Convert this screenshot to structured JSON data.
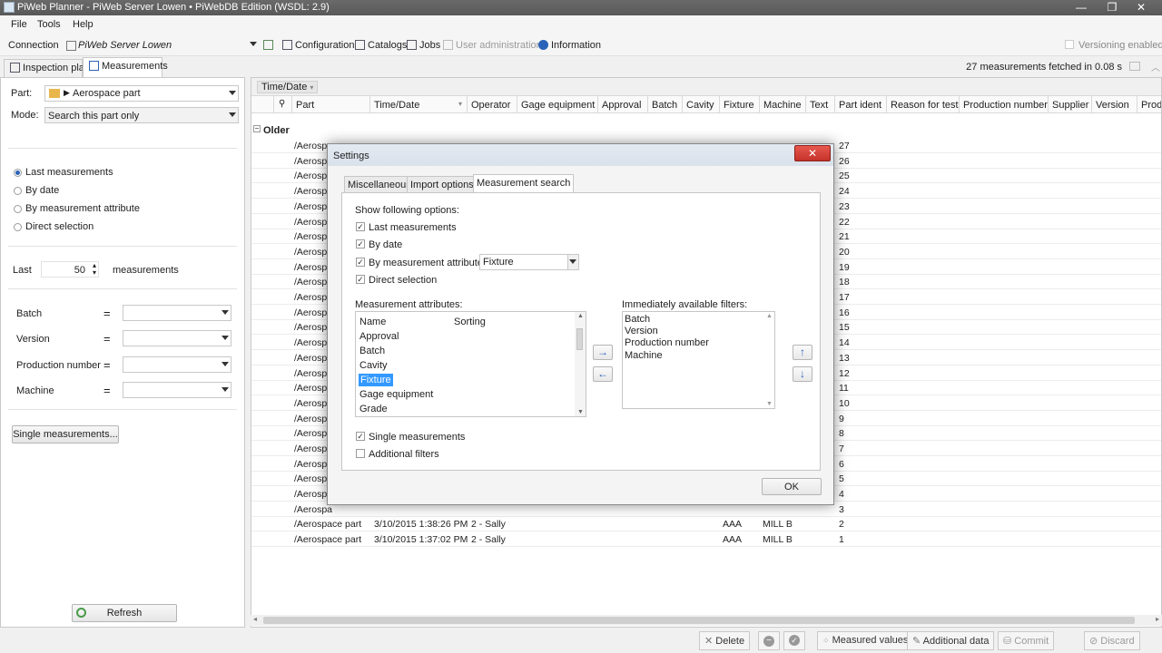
{
  "window": {
    "title": "PiWeb Planner - PiWeb Server Lowen • PiWebDB Edition (WSDL: 2.9)",
    "minimize": "—",
    "maximize": "❐",
    "close": "✕"
  },
  "menu": {
    "file": "File",
    "tools": "Tools",
    "help": "Help"
  },
  "toolbar": {
    "connection_label": "Connection",
    "connection_value": "PiWeb Server Lowen",
    "configuration": "Configuration",
    "catalogs": "Catalogs",
    "jobs": "Jobs",
    "user_admin": "User administration",
    "information": "Information",
    "versioning": "Versioning enabled"
  },
  "left": {
    "tab_inspection": "Inspection plan",
    "tab_measurements": "Measurements",
    "part_label": "Part:",
    "part_value": "Aerospace part",
    "mode_label": "Mode:",
    "mode_value": "Search this part only",
    "radios": [
      "Last measurements",
      "By date",
      "By measurement attribute",
      "Direct selection"
    ],
    "last_label": "Last",
    "last_value": "50",
    "measurements_label": "measurements",
    "filters": [
      {
        "label": "Batch",
        "op": "="
      },
      {
        "label": "Version",
        "op": "="
      },
      {
        "label": "Production number",
        "op": "="
      },
      {
        "label": "Machine",
        "op": "="
      }
    ],
    "single_button": "Single measurements...",
    "refresh_button": "Refresh"
  },
  "grid": {
    "fetched": "27 measurements fetched in 0.08 s",
    "group_by": "Time/Date",
    "group_label": "Older",
    "columns": [
      "Part",
      "Time/Date",
      "Operator",
      "Gage equipment",
      "Approval",
      "Batch",
      "Cavity",
      "Fixture",
      "Machine",
      "Text",
      "Part ident",
      "Reason for test",
      "Production number",
      "Supplier",
      "Version",
      "Prod"
    ],
    "left_rows_part": "/Aerospa",
    "row_idents": [
      "27",
      "26",
      "25",
      "24",
      "23",
      "22",
      "21",
      "20",
      "19",
      "18",
      "17",
      "16",
      "15",
      "14",
      "13",
      "12",
      "11",
      "10",
      "9",
      "8",
      "7",
      "6",
      "5",
      "4",
      "3"
    ],
    "rows": [
      {
        "part": "/Aerospace part",
        "time": "3/10/2015 1:38:26 PM",
        "operator": "2 - Sally",
        "fixture": "AAA",
        "machine": "MILL B",
        "ident": "2"
      },
      {
        "part": "/Aerospace part",
        "time": "3/10/2015 1:37:02 PM",
        "operator": "2 - Sally",
        "fixture": "AAA",
        "machine": "MILL B",
        "ident": "1"
      }
    ]
  },
  "bottom": {
    "delete": "Delete",
    "measured_values": "Measured values",
    "additional_data": "Additional data",
    "commit": "Commit",
    "discard": "Discard"
  },
  "dialog": {
    "title": "Settings",
    "close": "✕",
    "tabs": [
      "Miscellaneous",
      "Import options",
      "Measurement search"
    ],
    "show_options_label": "Show following options:",
    "options": [
      {
        "label": "Last measurements",
        "checked": true
      },
      {
        "label": "By date",
        "checked": true
      },
      {
        "label": "By measurement attribute",
        "checked": true
      },
      {
        "label": "Direct selection",
        "checked": true
      }
    ],
    "attribute_combo": "Fixture",
    "attributes_label": "Measurement attributes:",
    "attr_col_name": "Name",
    "attr_col_sorting": "Sorting",
    "attributes": [
      "Approval",
      "Batch",
      "Cavity",
      "Fixture",
      "Gage equipment",
      "Grade"
    ],
    "selected_attribute": "Fixture",
    "filters_label": "Immediately available filters:",
    "filters": [
      "Batch",
      "Version",
      "Production number",
      "Machine"
    ],
    "single_measurements": "Single measurements",
    "additional_filters": "Additional filters",
    "ok": "OK",
    "check_mark": "✓",
    "arrow_right": "→",
    "arrow_left": "←",
    "arrow_up": "↑",
    "arrow_down": "↓"
  }
}
